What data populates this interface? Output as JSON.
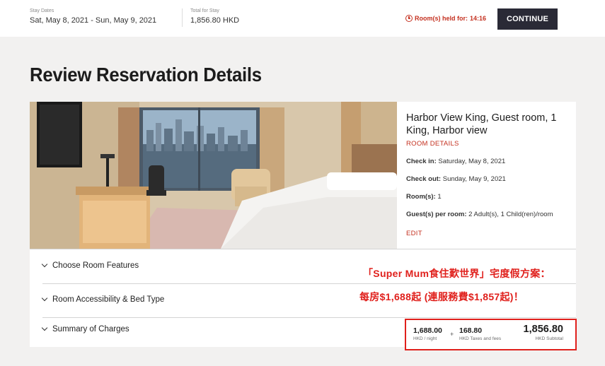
{
  "topbar": {
    "stay_dates_label": "Stay Dates",
    "stay_dates_value": "Sat, May 8, 2021 - Sun, May 9, 2021",
    "total_label": "Total for Stay",
    "total_value": "1,856.80 HKD",
    "held_label": "Room(s) held for:",
    "held_time": "14:16",
    "continue_label": "CONTINUE"
  },
  "page": {
    "title": "Review Reservation Details"
  },
  "room": {
    "name": "Harbor View King, Guest room, 1 King, Harbor view",
    "details_link": "ROOM DETAILS",
    "checkin_label": "Check in:",
    "checkin_value": "Saturday, May 8, 2021",
    "checkout_label": "Check out:",
    "checkout_value": "Sunday, May 9, 2021",
    "rooms_label": "Room(s):",
    "rooms_value": "1",
    "guests_label": "Guest(s) per room:",
    "guests_value": "2 Adult(s), 1 Child(ren)/room",
    "edit_link": "EDIT"
  },
  "sections": {
    "features": "Choose Room Features",
    "accessibility": "Room Accessibility & Bed Type",
    "charges": "Summary of Charges"
  },
  "promo": {
    "line1": "「Super Mum食住歎世界」宅度假方案：",
    "line2": "每房$1,688起 (連服務費$1,857起)！"
  },
  "charges": {
    "nightly_value": "1,688.00",
    "nightly_label": "HKD / night",
    "plus": "+",
    "taxes_value": "168.80",
    "taxes_label": "HKD Taxes and fees",
    "subtotal_value": "1,856.80",
    "subtotal_label": "HKD Subtotal"
  },
  "colors": {
    "accent_red": "#c4301f",
    "promo_red": "#e0201c",
    "button_dark": "#2a2a36",
    "page_bg": "#f2f1f0"
  }
}
